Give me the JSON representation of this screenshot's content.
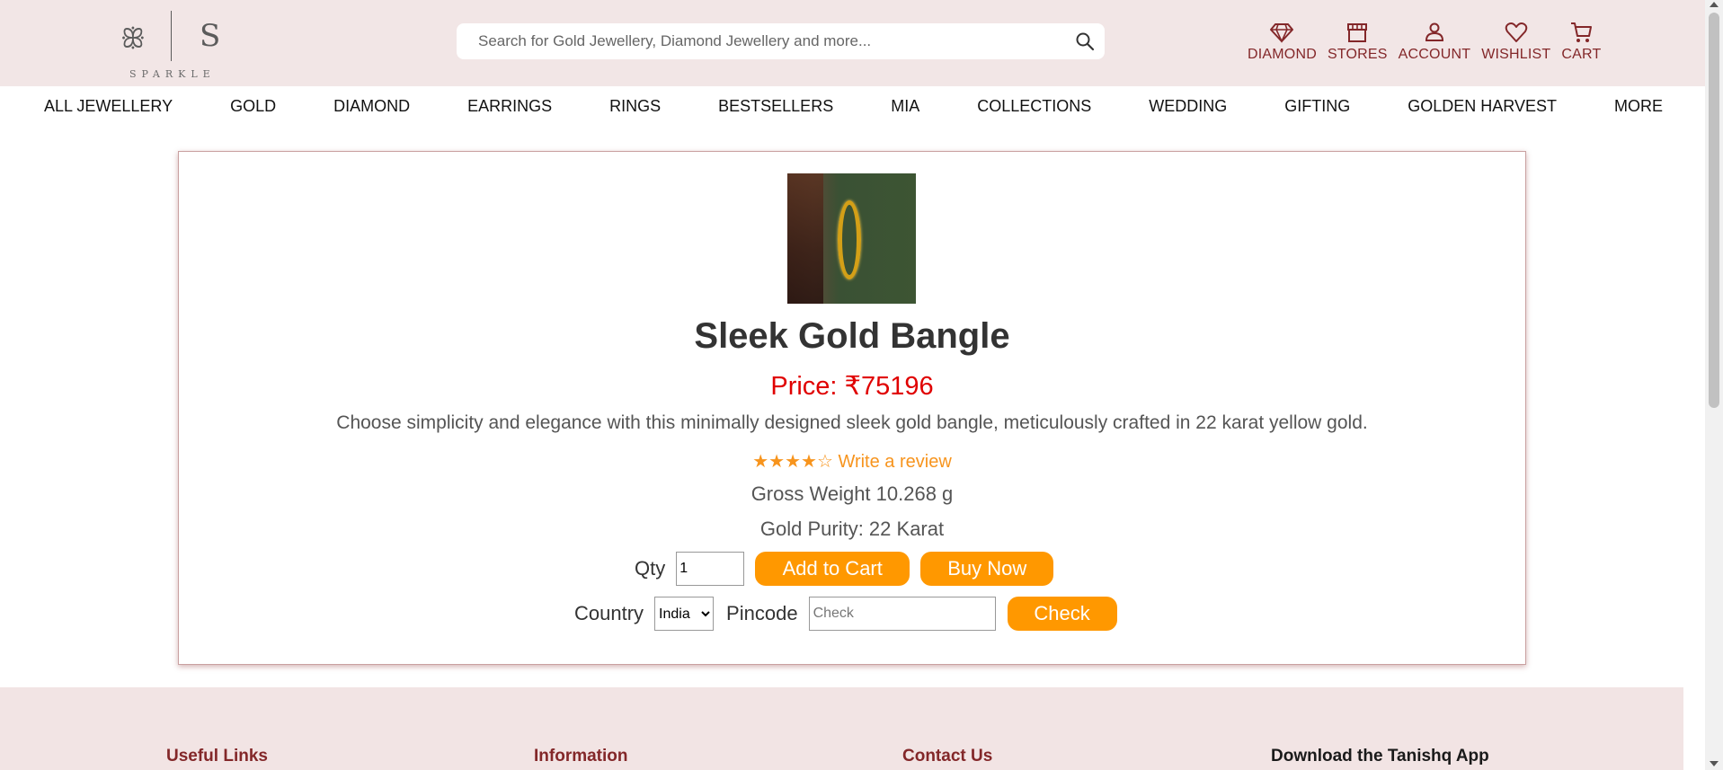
{
  "brand": {
    "logo_glyph": "ꕥ",
    "logo_letter": "S",
    "logo_text": "SPARKLE"
  },
  "search": {
    "placeholder": "Search for Gold Jewellery, Diamond Jewellery and more...",
    "icon": "search-icon"
  },
  "header_actions": [
    {
      "label": "DIAMOND",
      "icon": "diamond-icon"
    },
    {
      "label": "STORES",
      "icon": "store-icon"
    },
    {
      "label": "ACCOUNT",
      "icon": "account-icon"
    },
    {
      "label": "WISHLIST",
      "icon": "heart-icon"
    },
    {
      "label": "CART",
      "icon": "cart-icon"
    }
  ],
  "nav": {
    "items": [
      "ALL JEWELLERY",
      "GOLD",
      "DIAMOND",
      "EARRINGS",
      "RINGS",
      "BESTSELLERS",
      "MIA",
      "COLLECTIONS",
      "WEDDING",
      "GIFTING",
      "GOLDEN HARVEST",
      "MORE"
    ]
  },
  "product": {
    "title": "Sleek Gold Bangle",
    "price": "Price: ₹75196",
    "description": "Choose simplicity and elegance with this minimally designed sleek gold bangle, meticulously crafted in 22 karat yellow gold.",
    "stars": "★★★★☆",
    "rating_value": 4,
    "review_link": "Write a review",
    "gross_weight": "Gross Weight 10.268 g",
    "purity": "Gold Purity: 22 Karat"
  },
  "purchase": {
    "qty_label": "Qty",
    "qty_value": "1",
    "add_to_cart": "Add to Cart",
    "buy_now": "Buy Now",
    "country_label": "Country",
    "country_selected": "India",
    "pincode_label": "Pincode",
    "pincode_placeholder": "Check",
    "check_button": "Check"
  },
  "footer": {
    "columns": [
      "Useful Links",
      "Information",
      "Contact Us",
      "Download the Tanishq App"
    ]
  },
  "colors": {
    "brand": "#832729",
    "header_bg": "#f2e6e6",
    "button": "#ff9800",
    "price": "#e00000",
    "rating": "#f7941d"
  }
}
